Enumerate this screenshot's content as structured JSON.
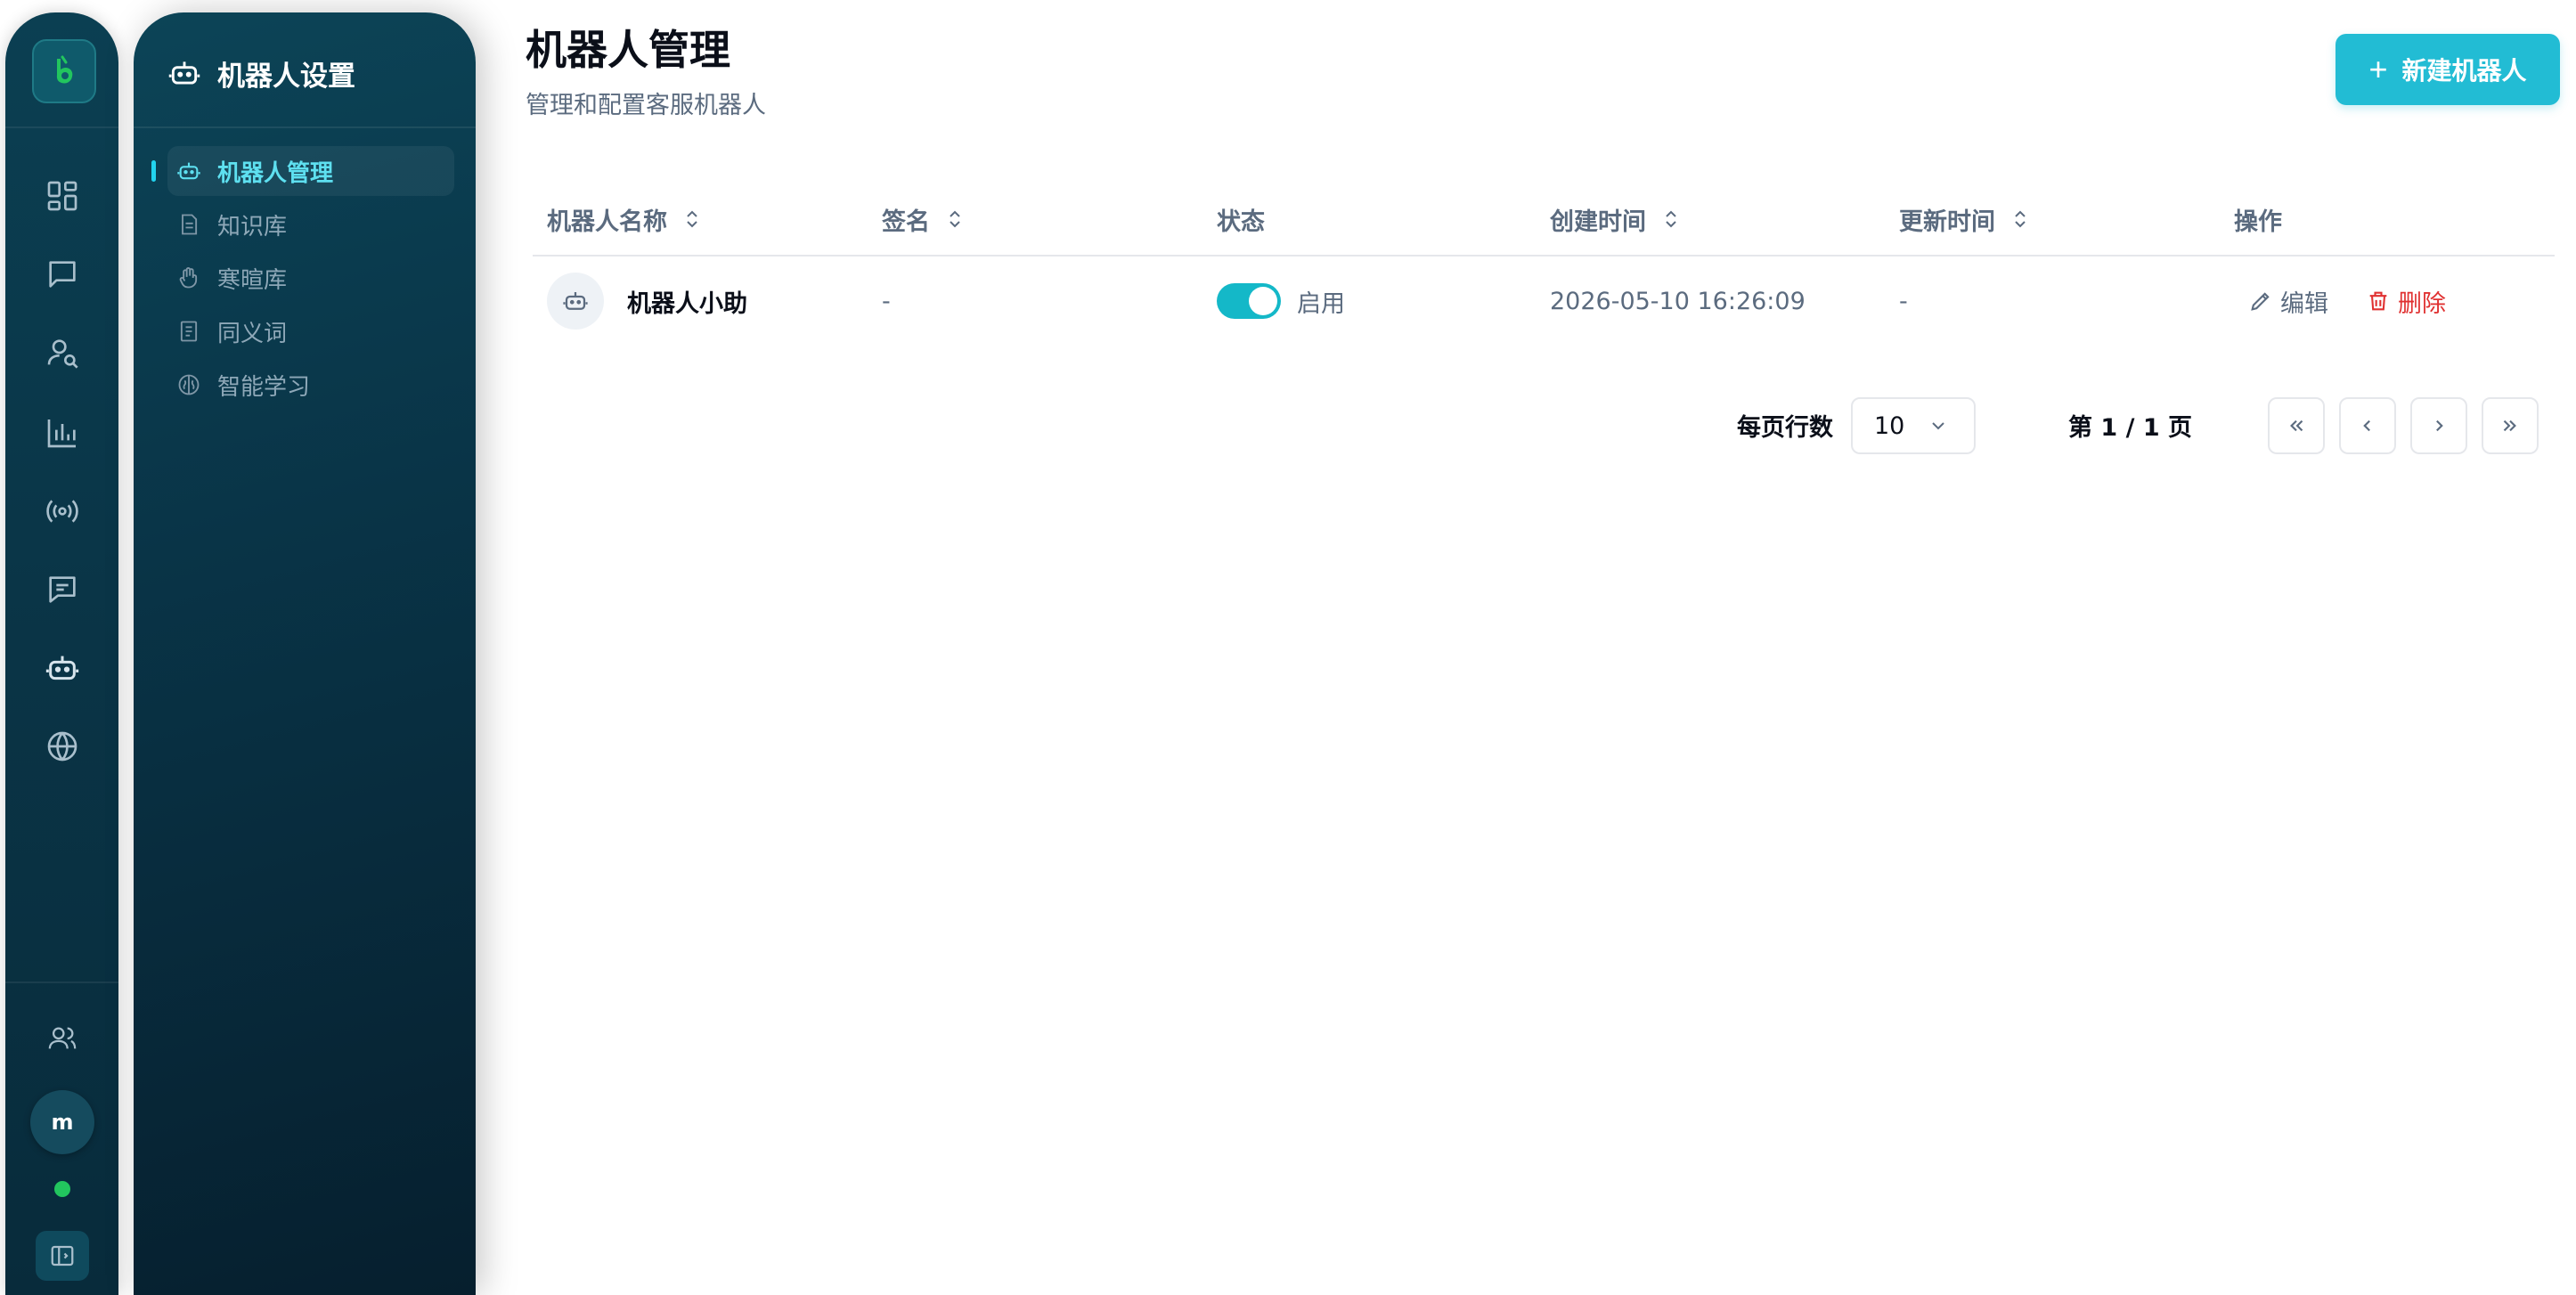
{
  "rail": {
    "logo_icon": "brand-logo-icon",
    "nav_icons": [
      "dashboard-icon",
      "chat-icon",
      "user-search-icon",
      "analytics-icon",
      "broadcast-icon",
      "message-icon",
      "robot-icon",
      "globe-icon"
    ],
    "team_icon": "users-icon",
    "avatar_initial": "m",
    "online_color": "#22c55e"
  },
  "subnav": {
    "title": "机器人设置",
    "items": [
      {
        "label": "机器人管理",
        "icon": "robot-icon",
        "active": true
      },
      {
        "label": "知识库",
        "icon": "document-icon",
        "active": false
      },
      {
        "label": "寒暄库",
        "icon": "hand-wave-icon",
        "active": false
      },
      {
        "label": "同义词",
        "icon": "book-icon",
        "active": false
      },
      {
        "label": "智能学习",
        "icon": "brain-icon",
        "active": false
      }
    ]
  },
  "page": {
    "title": "机器人管理",
    "subtitle": "管理和配置客服机器人",
    "new_button_label": "新建机器人"
  },
  "table": {
    "columns": [
      "机器人名称",
      "签名",
      "状态",
      "创建时间",
      "更新时间",
      "操作"
    ],
    "rows": [
      {
        "name": "机器人小助",
        "signature": "-",
        "status_label": "启用",
        "status_enabled": true,
        "created_at": "2026-05-10 16:26:09",
        "updated_at": "-",
        "edit_label": "编辑",
        "delete_label": "删除"
      }
    ]
  },
  "pagination": {
    "rows_per_page_label": "每页行数",
    "rows_per_page_value": "10",
    "page_info": "第 1 / 1 页"
  },
  "colors": {
    "accent": "#22bcd4",
    "sidebar_dark": "#0a3547",
    "active_text": "#5ee0f0",
    "danger": "#e03131",
    "toggle_on": "#14b8c8"
  }
}
